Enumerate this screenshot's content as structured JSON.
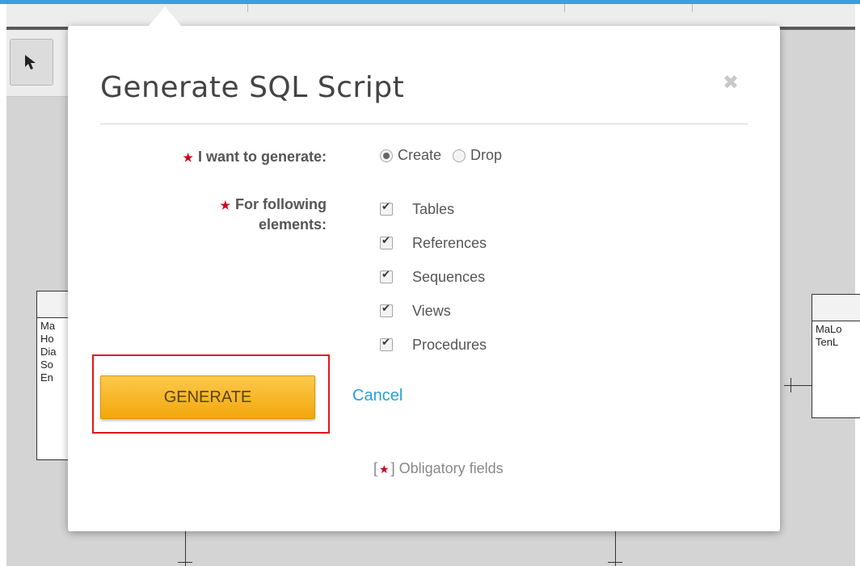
{
  "dialog": {
    "title": "Generate SQL Script",
    "close_icon": "close-icon"
  },
  "form": {
    "generate_label": "I want to generate:",
    "generate_options": [
      {
        "label": "Create",
        "selected": true
      },
      {
        "label": "Drop",
        "selected": false
      }
    ],
    "elements_label_line1": "For following",
    "elements_label_line2": "elements:",
    "elements": [
      {
        "label": "Tables",
        "checked": true
      },
      {
        "label": "References",
        "checked": true
      },
      {
        "label": "Sequences",
        "checked": true
      },
      {
        "label": "Views",
        "checked": true
      },
      {
        "label": "Procedures",
        "checked": true
      }
    ],
    "required_marker": "★"
  },
  "actions": {
    "generate_label": "GENERATE",
    "cancel_label": "Cancel"
  },
  "footer": {
    "obligatory_open": "[",
    "obligatory_close": "] Obligatory fields"
  },
  "background": {
    "entity_left_attrs": [
      "Ma",
      "Ho",
      "Dia",
      "So",
      "En"
    ],
    "entity_right_attrs": [
      "MaLo",
      "TenL"
    ]
  },
  "colors": {
    "accent": "#2a9fd6",
    "required": "#d0021b",
    "button": "#f3a70b",
    "highlight": "#e4141b"
  }
}
